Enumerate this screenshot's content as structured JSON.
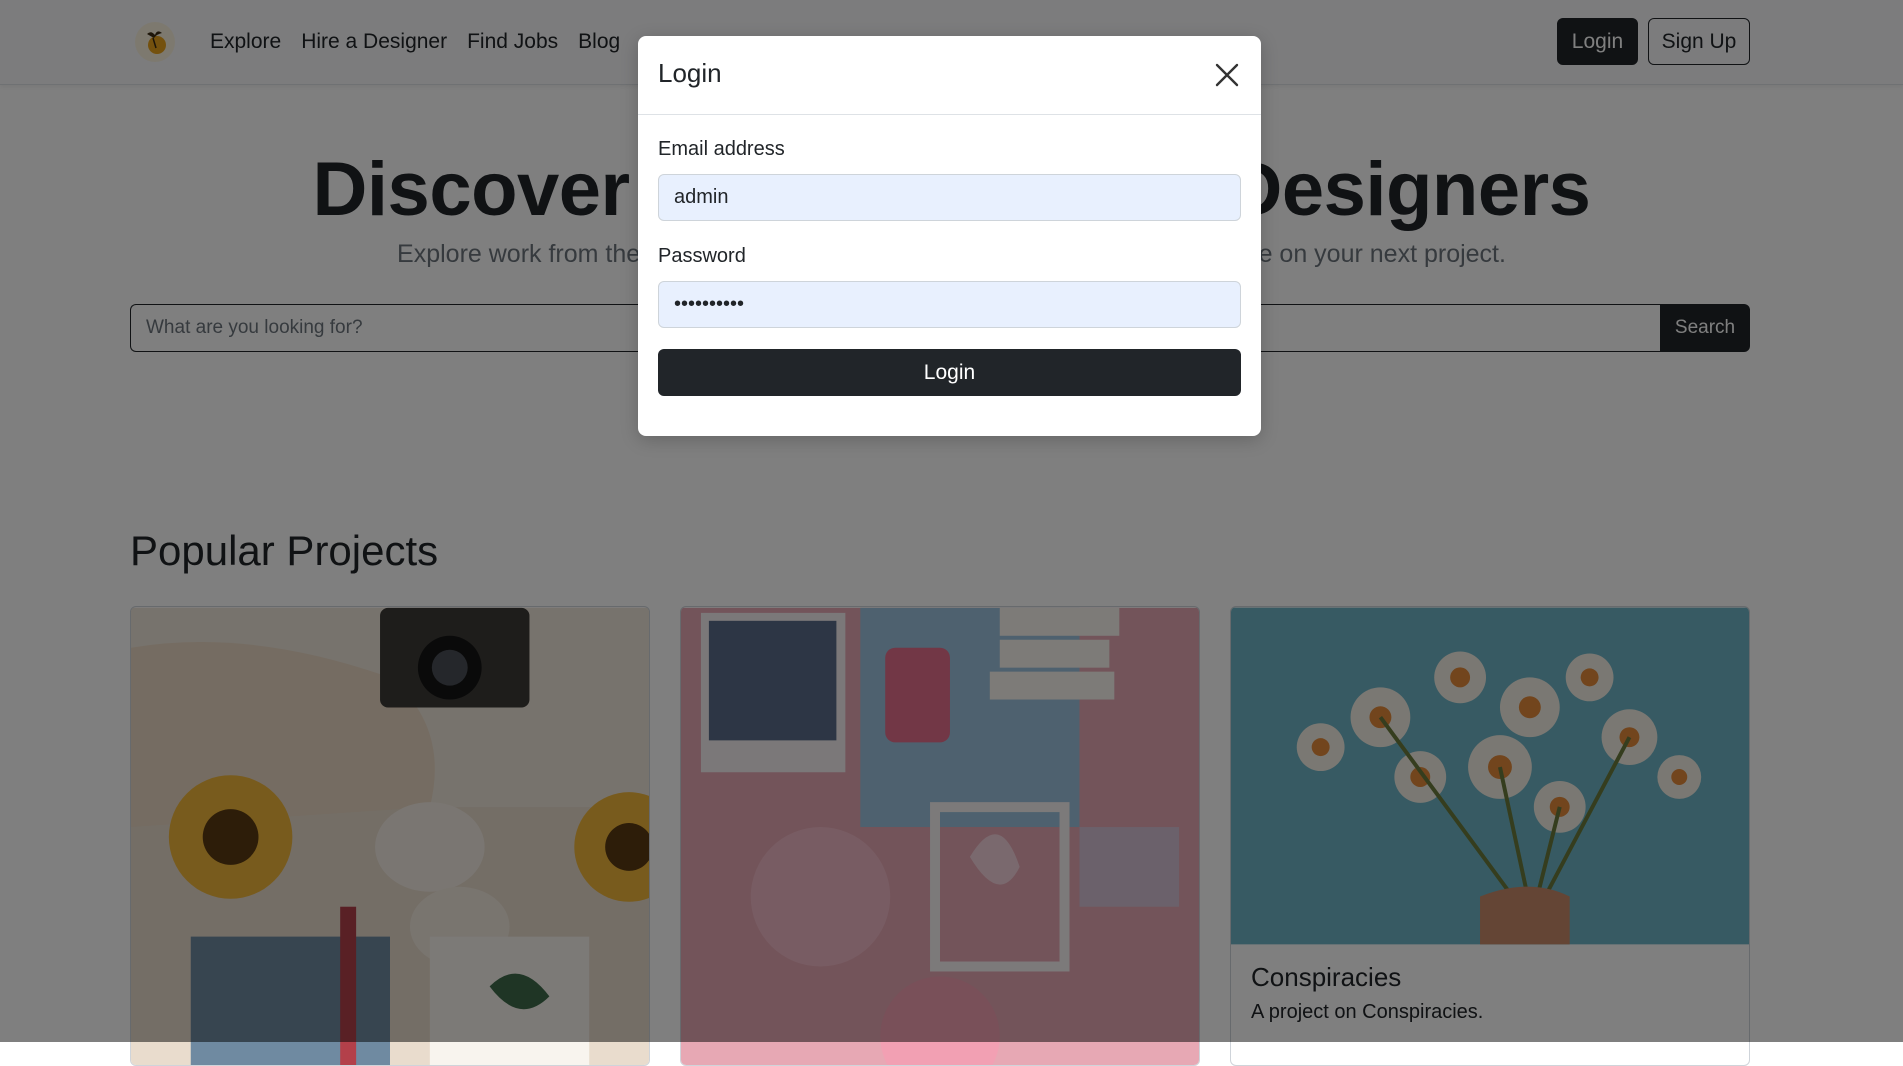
{
  "nav": {
    "links": [
      "Explore",
      "Hire a Designer",
      "Find Jobs",
      "Blog"
    ],
    "login_label": "Login",
    "signup_label": "Sign Up"
  },
  "hero": {
    "title": "Discover the World's Top Designers",
    "subtitle": "Explore work from the most talented and accomplished designers ready to take on your next project."
  },
  "search": {
    "placeholder": "What are you looking for?",
    "button_label": "Search"
  },
  "projects": {
    "title": "Popular Projects",
    "cards": [
      {
        "title": "",
        "text": ""
      },
      {
        "title": "",
        "text": ""
      },
      {
        "title": "Conspiracies",
        "text": "A project on Conspiracies."
      }
    ]
  },
  "modal": {
    "title": "Login",
    "email_label": "Email address",
    "email_value": "admin",
    "password_label": "Password",
    "password_value": "••••••••••",
    "submit_label": "Login"
  },
  "colors": {
    "primary_dark": "#212529",
    "navbar_bg": "#f8f9fa",
    "autofill_bg": "#e8f0fe",
    "backdrop": "rgba(0,0,0,0.5)"
  }
}
